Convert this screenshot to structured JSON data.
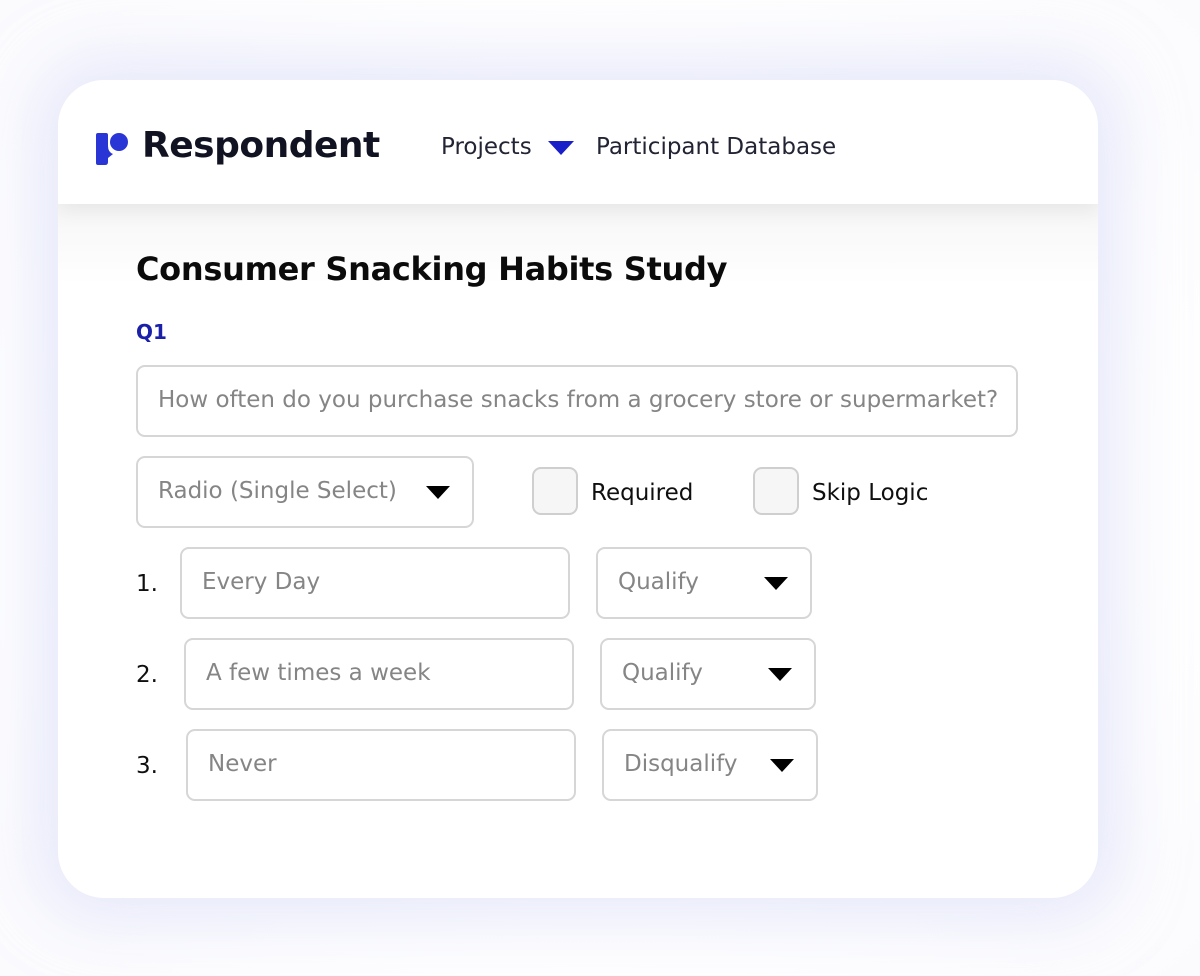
{
  "header": {
    "brand": "Respondent",
    "logo_icon": "respondent-logo-icon",
    "nav": {
      "projects": "Projects",
      "projects_icon": "chevron-down-icon",
      "participant_database": "Participant Database"
    }
  },
  "study": {
    "title": "Consumer Snacking Habits Study"
  },
  "question": {
    "label": "Q1",
    "text": "How often do you purchase snacks from a grocery store or supermarket?",
    "type": "Radio (Single Select)",
    "required_label": "Required",
    "skip_logic_label": "Skip Logic"
  },
  "answers": [
    {
      "number": "1.",
      "text": "Every Day",
      "logic": "Qualify"
    },
    {
      "number": "2.",
      "text": "A few times a week",
      "logic": "Qualify"
    },
    {
      "number": "3.",
      "text": "Never",
      "logic": "Disqualify"
    }
  ],
  "colors": {
    "brand": "#2a35d6",
    "accent": "#1a20a8",
    "text": "#111322",
    "muted": "#858585",
    "border": "#d6d6d6"
  }
}
